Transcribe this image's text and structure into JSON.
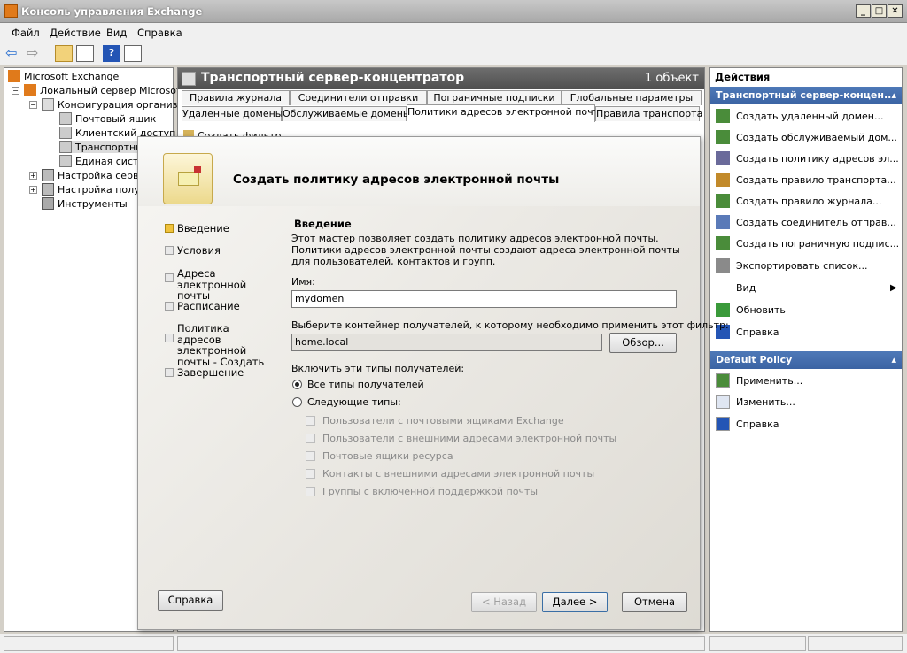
{
  "window": {
    "title": "Консоль управления Exchange"
  },
  "menu": [
    "Файл",
    "Действие",
    "Вид",
    "Справка"
  ],
  "tree": {
    "root": "Microsoft Exchange",
    "local_server": "Локальный сервер Microsoft E",
    "org_config": "Конфигурация организац",
    "mailbox": "Почтовый ящик",
    "client_access": "Клиентский доступ",
    "transport": "Транспортны",
    "unified": "Единая систе",
    "server_config": "Настройка серве",
    "recipient_config": "Настройка получ",
    "tools": "Инструменты"
  },
  "center": {
    "title": "Транспортный сервер-концентратор",
    "count": "1 объект",
    "tabs_row1": [
      "Правила журнала",
      "Соединители отправки",
      "Пограничные подписки",
      "Глобальные параметры"
    ],
    "tabs_row2": [
      "Удаленные домены",
      "Обслуживаемые домены",
      "Политики адресов электронной почты",
      "Правила транспорта"
    ],
    "filter": "Создать фильтр"
  },
  "actions": {
    "header": "Действия",
    "section1": "Транспортный сервер-концен...",
    "items1": [
      "Создать удаленный домен...",
      "Создать обслуживаемый дом...",
      "Создать политику адресов эл...",
      "Создать правило транспорта...",
      "Создать правило журнала...",
      "Создать соединитель отправ...",
      "Создать пограничную подпис...",
      "Экспортировать список...",
      "Вид",
      "Обновить",
      "Справка"
    ],
    "section2": "Default Policy",
    "items2": [
      "Применить...",
      "Изменить...",
      "Справка"
    ]
  },
  "wizard": {
    "title": "Создать политику адресов электронной почты",
    "steps": [
      "Введение",
      "Условия",
      "Адреса электронной почты",
      "Расписание",
      "Политика адресов электронной почты - Создать",
      "Завершение"
    ],
    "section_title": "Введение",
    "intro": "Этот мастер позволяет создать политику адресов электронной почты. Политики адресов электронной почты создают адреса электронной почты для пользователей, контактов и групп.",
    "name_label": "Имя:",
    "name_value": "mydomen",
    "container_label": "Выберите контейнер получателей, к которому необходимо применить этот фильтр:",
    "container_value": "home.local",
    "browse": "Обзор...",
    "include_label": "Включить эти типы получателей:",
    "radio_all": "Все типы получателей",
    "radio_following": "Следующие типы:",
    "checkboxes": [
      "Пользователи с почтовыми ящиками Exchange",
      "Пользователи с внешними адресами электронной почты",
      "Почтовые ящики ресурса",
      "Контакты с внешними адресами электронной почты",
      "Группы с включенной поддержкой почты"
    ],
    "help": "Справка",
    "back": "< Назад",
    "next": "Далее >",
    "cancel": "Отмена"
  }
}
